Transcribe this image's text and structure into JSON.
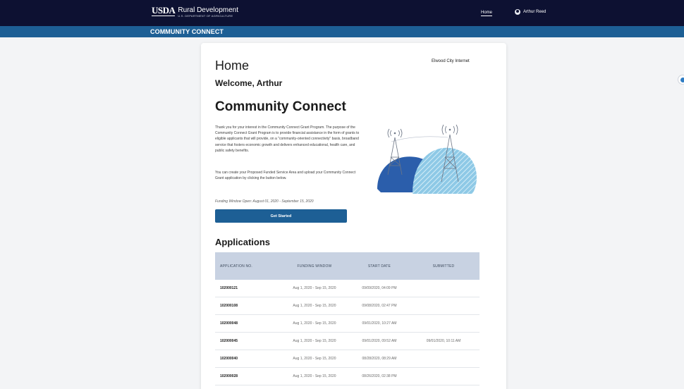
{
  "header": {
    "brand_usda": "USDA",
    "brand_title": "Rural Development",
    "brand_sub": "U.S. DEPARTMENT OF AGRICULTURE",
    "nav_home": "Home",
    "user_name": "Arthur Reed"
  },
  "subheader": {
    "title": "COMMUNITY CONNECT"
  },
  "main": {
    "org_name": "Elwood City Internet",
    "title": "Home",
    "welcome": "Welcome, Arthur",
    "program_title": "Community Connect",
    "intro": "Thank you for your interest in the Community Connect Grant Program. The purpose of the Community Connect Grant Program is to provide financial assistance in the form of grants to eligible applicants that will provide, on a \"community-oriented connectivity\" basis, broadband service that fosters economic growth and delivers enhanced educational, health care, and public safety benefits.",
    "instructions": "You can create your Proposed Funded Service Area and upload your Community Connect Grant application by clicking the button below.",
    "funding_window": "Funding Window Open: August 01, 2020 - September 15, 2020",
    "get_started": "Get Started"
  },
  "applications": {
    "title": "Applications",
    "columns": [
      "APPLICATION NO.",
      "FUNDING WINDOW",
      "START DATE",
      "SUBMITTED"
    ],
    "rows": [
      [
        "102000121",
        "Aug 1, 2020 - Sep 15, 2020",
        "09/09/2020, 04:09 PM",
        ""
      ],
      [
        "102000108",
        "Aug 1, 2020 - Sep 15, 2020",
        "09/08/2020, 02:47 PM",
        ""
      ],
      [
        "102000048",
        "Aug 1, 2020 - Sep 15, 2020",
        "09/01/2020, 10:27 AM",
        ""
      ],
      [
        "102000045",
        "Aug 1, 2020 - Sep 15, 2020",
        "09/01/2020, 09:52 AM",
        "09/01/2020, 10:11 AM"
      ],
      [
        "102000040",
        "Aug 1, 2020 - Sep 15, 2020",
        "08/28/2020, 08:29 AM",
        ""
      ],
      [
        "102000028",
        "Aug 1, 2020 - Sep 15, 2020",
        "08/26/2020, 02:38 PM",
        ""
      ]
    ]
  },
  "colors": {
    "topbar": "#0d1132",
    "subbar": "#1d5f95",
    "accent": "#1d5f95",
    "table_header": "#c8d2e2"
  },
  "icons": {
    "user": "user-circle-icon",
    "illustration": "broadband-towers-illustration",
    "side_badge": "help-globe-icon"
  }
}
